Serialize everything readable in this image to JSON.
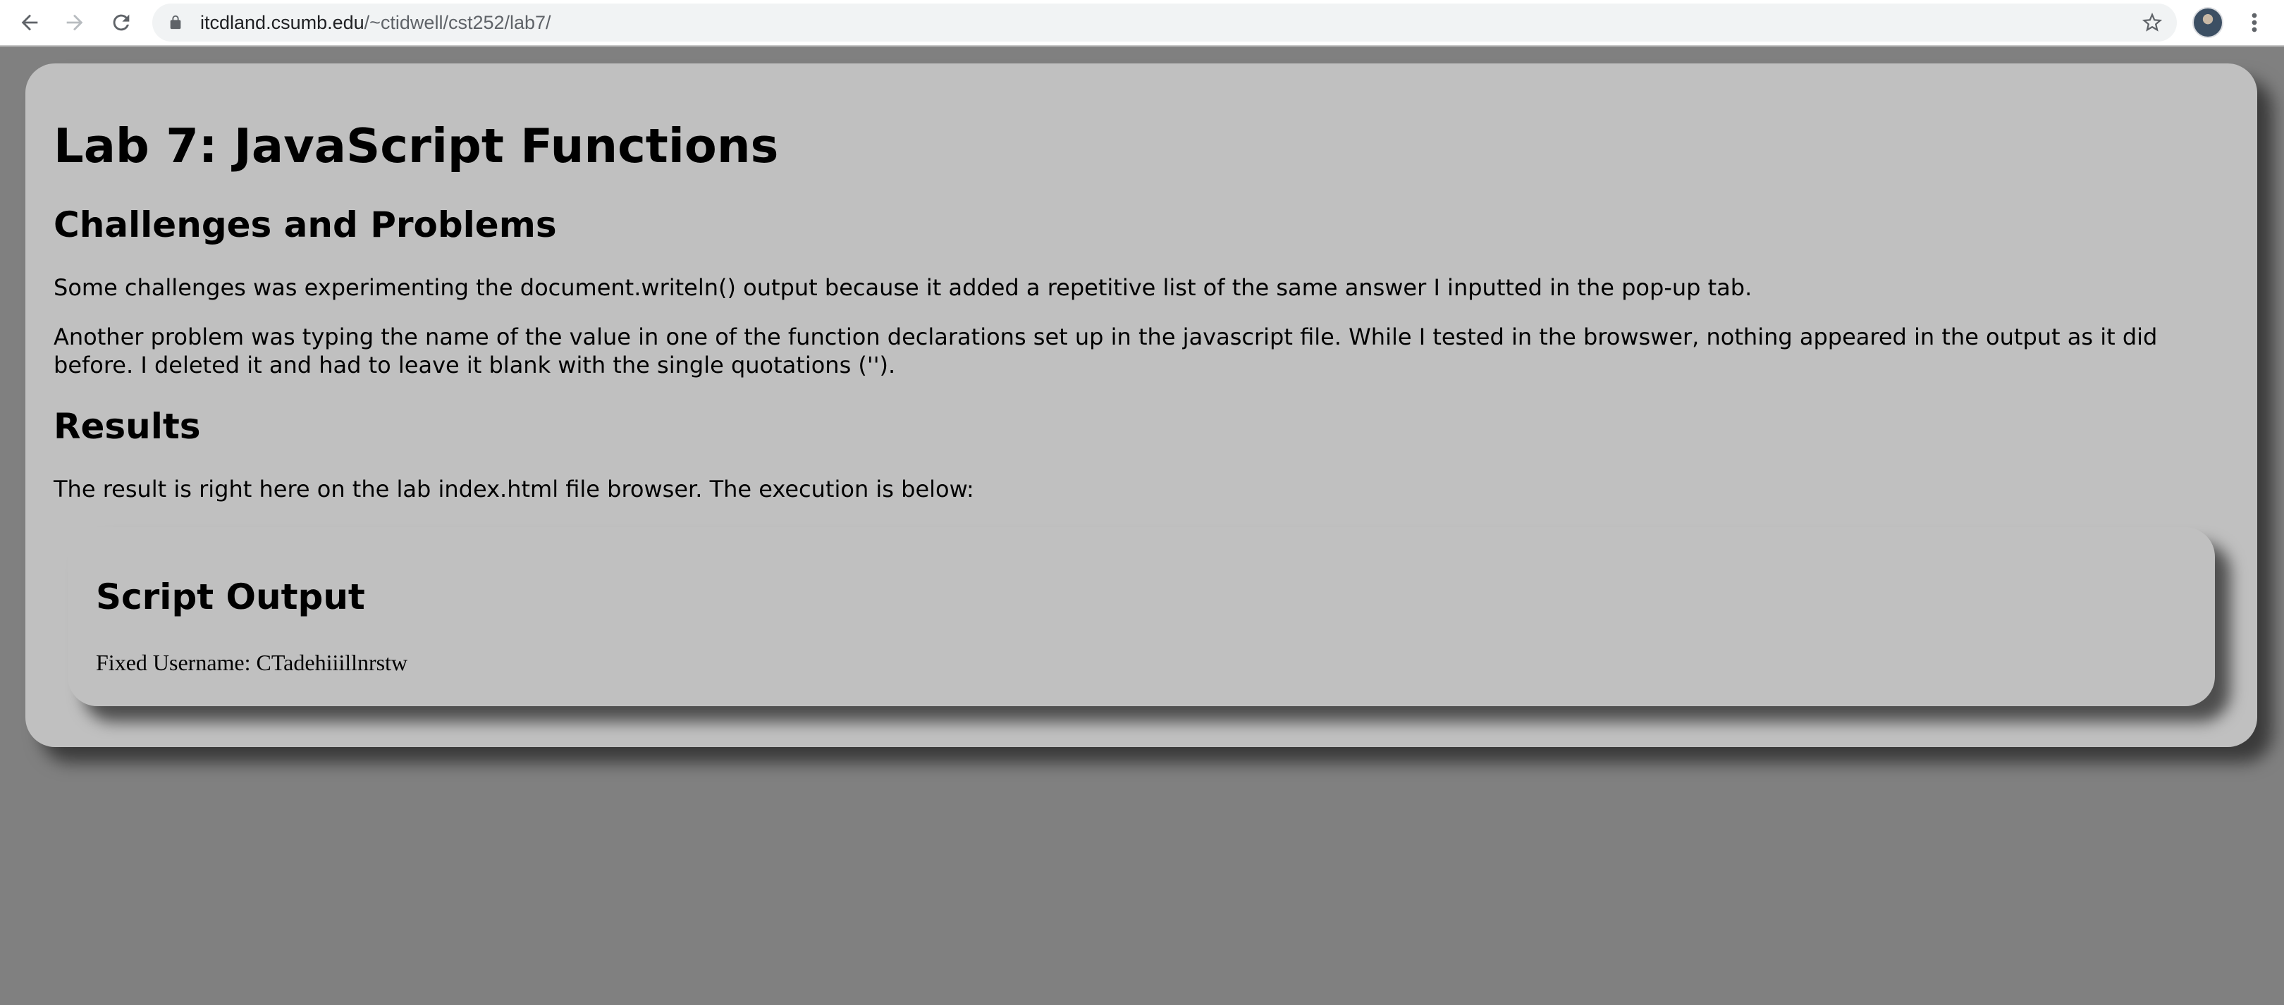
{
  "browser": {
    "url_host": "itcdland.csumb.edu",
    "url_path": "/~ctidwell/cst252/lab7/",
    "icons": [
      "back-icon",
      "forward-icon",
      "reload-icon",
      "lock-icon",
      "star-icon",
      "avatar",
      "menu-icon"
    ]
  },
  "page": {
    "title": "Lab 7: JavaScript Functions",
    "challenges_heading": "Challenges and Problems",
    "challenges_p1": "Some challenges was experimenting the document.writeln() output because it added a repetitive list of the same answer I inputted in the pop-up tab.",
    "challenges_p2": "Another problem was typing the name of the value in one of the function declarations set up in the javascript file. While I tested in the browswer, nothing appeared in the output as it did before. I deleted it and had to leave it blank with the single quotations ('').",
    "results_heading": "Results",
    "results_p": "The result is right here on the lab index.html file browser. The execution is below:"
  },
  "output": {
    "heading": "Script Output",
    "line": "Fixed Username: CTadehiiillnrstw"
  },
  "colors": {
    "page_background": "#808080",
    "card_background": "#c0c0c0"
  }
}
